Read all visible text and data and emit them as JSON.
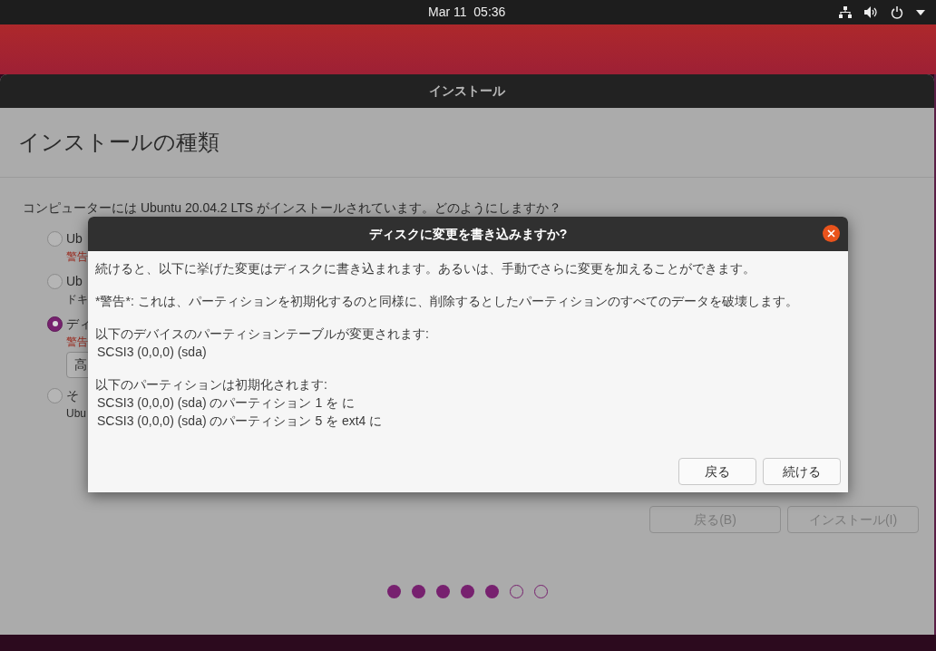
{
  "top_bar": {
    "clock": "Mar 11  05:36"
  },
  "window": {
    "title": "インストール"
  },
  "page": {
    "heading": "インストールの種類",
    "question": "コンピューターには Ubuntu 20.04.2 LTS がインストールされています。どのようにしますか？",
    "options": [
      {
        "label": "Ub",
        "note": "警告",
        "kind": "warning",
        "selected": false
      },
      {
        "label": "Ub",
        "note": "ドキ",
        "kind": "info",
        "selected": false
      },
      {
        "label": "ディ",
        "note": "警告",
        "kind": "warning",
        "selected": true,
        "dropdown": "高"
      },
      {
        "label": "そ",
        "note": "Ubu",
        "kind": "info",
        "selected": false
      }
    ],
    "buttons": [
      {
        "label": "戻る(B)",
        "disabled": true
      },
      {
        "label": "インストール(I)",
        "disabled": true
      }
    ],
    "progress_dots": [
      {
        "filled": true
      },
      {
        "filled": true
      },
      {
        "filled": true
      },
      {
        "filled": true
      },
      {
        "filled": true
      },
      {
        "filled": false
      },
      {
        "filled": false
      }
    ]
  },
  "dialog": {
    "title": "ディスクに変更を書き込みますか?",
    "sections": [
      {
        "heading": "続けると、以下に挙げた変更はディスクに書き込まれます。あるいは、手動でさらに変更を加えることができます。"
      },
      {
        "heading": "*警告*: これは、パーティションを初期化するのと同様に、削除するとしたパーティションのすべてのデータを破壊します。"
      },
      {
        "heading": "以下のデバイスのパーティションテーブルが変更されます:",
        "items": [
          "SCSI3 (0,0,0) (sda)"
        ]
      },
      {
        "heading": "以下のパーティションは初期化されます:",
        "items": [
          "SCSI3 (0,0,0) (sda) のパーティション 1 を に",
          "SCSI3 (0,0,0) (sda) のパーティション 5 を ext4 に"
        ]
      }
    ],
    "buttons": [
      "戻る",
      "続ける"
    ]
  }
}
